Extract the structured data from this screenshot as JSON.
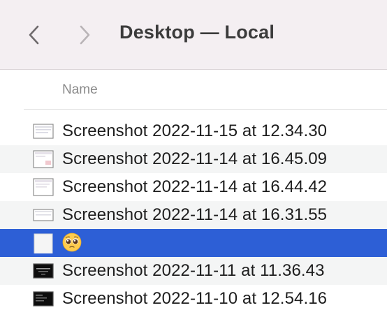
{
  "window": {
    "title": "Desktop — Local"
  },
  "toolbar": {
    "back_icon": "chevron-left-icon",
    "forward_icon": "chevron-right-icon"
  },
  "columns": {
    "name": "Name"
  },
  "files": [
    {
      "name": "Screenshot 2022-11-15 at 12.34.30",
      "icon": "screenshot-thumbnail-light"
    },
    {
      "name": "Screenshot 2022-11-14 at 16.45.09",
      "icon": "screenshot-thumbnail-light"
    },
    {
      "name": "Screenshot 2022-11-14 at 16.44.42",
      "icon": "screenshot-thumbnail-light"
    },
    {
      "name": "Screenshot 2022-11-14 at 16.31.55",
      "icon": "screenshot-thumbnail-light"
    },
    {
      "name": "",
      "icon": "blank-document",
      "emoji": "pleading-face",
      "selected": true
    },
    {
      "name": "Screenshot 2022-11-11 at 11.36.43",
      "icon": "screenshot-thumbnail-dark"
    },
    {
      "name": "Screenshot 2022-11-10 at 12.54.16",
      "icon": "screenshot-thumbnail-dark"
    }
  ],
  "colors": {
    "titlebar_bg": "#f4eff2",
    "selection": "#2d5fd6",
    "alt_row": "#f4f5f5",
    "text": "#1e1e1e",
    "header_text": "#8a8a8a"
  }
}
